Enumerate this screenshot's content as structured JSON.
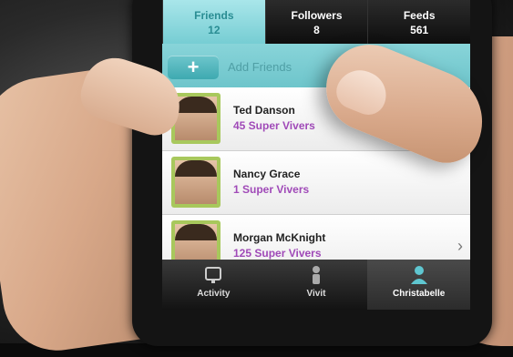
{
  "tabs": [
    {
      "label": "Friends",
      "count": "12"
    },
    {
      "label": "Followers",
      "count": "8"
    },
    {
      "label": "Feeds",
      "count": "561"
    }
  ],
  "add_bar": {
    "button_label": "+",
    "label": "Add Friends"
  },
  "friends": [
    {
      "name": "Ted Danson",
      "subtitle": "45 Super Vivers"
    },
    {
      "name": "Nancy Grace",
      "subtitle": "1 Super Vivers"
    },
    {
      "name": "Morgan McKnight",
      "subtitle": "125 Super Vivers"
    }
  ],
  "chevron": "›",
  "bottom_tabs": [
    {
      "label": "Activity",
      "icon": "activity-icon"
    },
    {
      "label": "Vivit",
      "icon": "person-icon"
    },
    {
      "label": "Christabelle",
      "icon": "profile-icon"
    }
  ],
  "colors": {
    "accent": "#76cdd3",
    "subtitle": "#a04ab8",
    "avatar_frame": "#a8c85c"
  }
}
